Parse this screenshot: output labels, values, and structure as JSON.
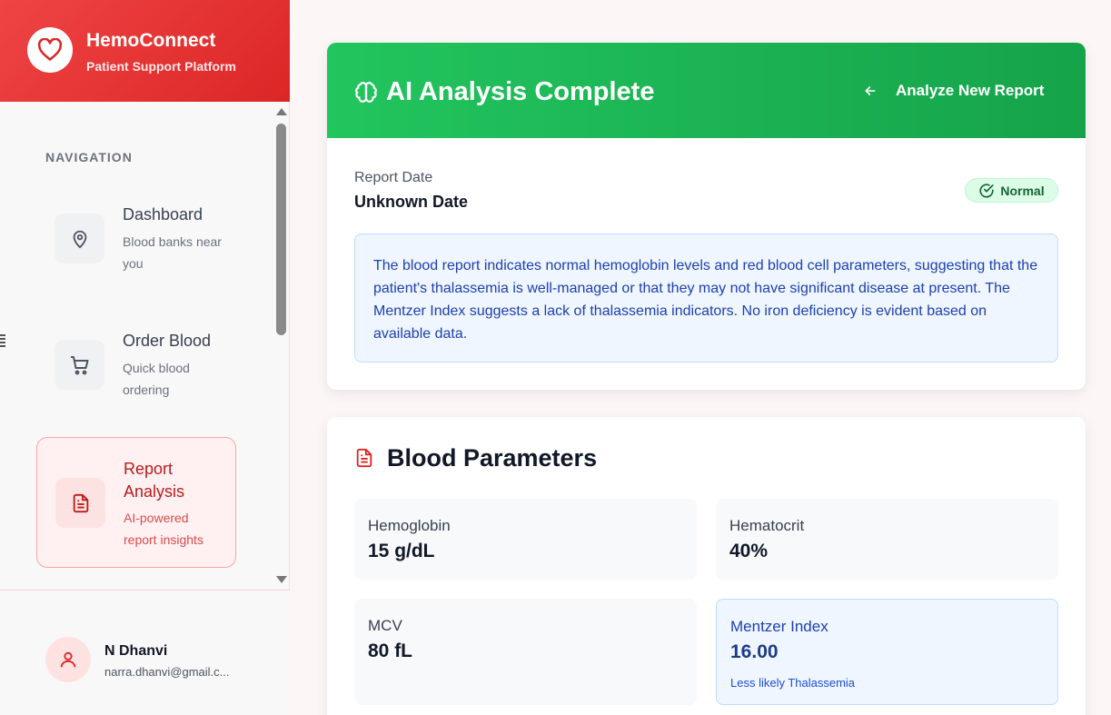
{
  "brand": {
    "title": "HemoConnect",
    "subtitle": "Patient Support Platform",
    "logo_icon": "heart-icon",
    "accent": "#dc2626"
  },
  "sidebar": {
    "heading": "NAVIGATION",
    "items": [
      {
        "label": "Dashboard",
        "desc": "Blood banks near you",
        "icon": "map-pin-icon",
        "active": false
      },
      {
        "label": "Order Blood",
        "desc": "Quick blood ordering",
        "icon": "cart-icon",
        "active": false
      },
      {
        "label": "Report Analysis",
        "desc": "AI-powered report insights",
        "icon": "document-icon",
        "active": true
      }
    ]
  },
  "user": {
    "name": "N Dhanvi",
    "email": "narra.dhanvi@gmail.c..."
  },
  "analysis": {
    "title": "AI Analysis Complete",
    "analyze_new_label": "Analyze New Report",
    "report_date_label": "Report Date",
    "report_date": "Unknown Date",
    "status": "Normal",
    "status_color": "#166534",
    "header_color": "#22c55e",
    "summary": "The blood report indicates normal hemoglobin levels and red blood cell parameters, suggesting that the patient's thalassemia is well-managed or that they may not have significant disease at present. The Mentzer Index suggests a lack of thalassemia indicators. No iron deficiency is evident based on available data."
  },
  "params": {
    "title": "Blood Parameters",
    "items": [
      {
        "label": "Hemoglobin",
        "value": "15 g/dL"
      },
      {
        "label": "Hematocrit",
        "value": "40%"
      },
      {
        "label": "MCV",
        "value": "80 fL"
      },
      {
        "label": "Mentzer Index",
        "value": "16.00",
        "note": "Less likely Thalassemia"
      }
    ]
  }
}
